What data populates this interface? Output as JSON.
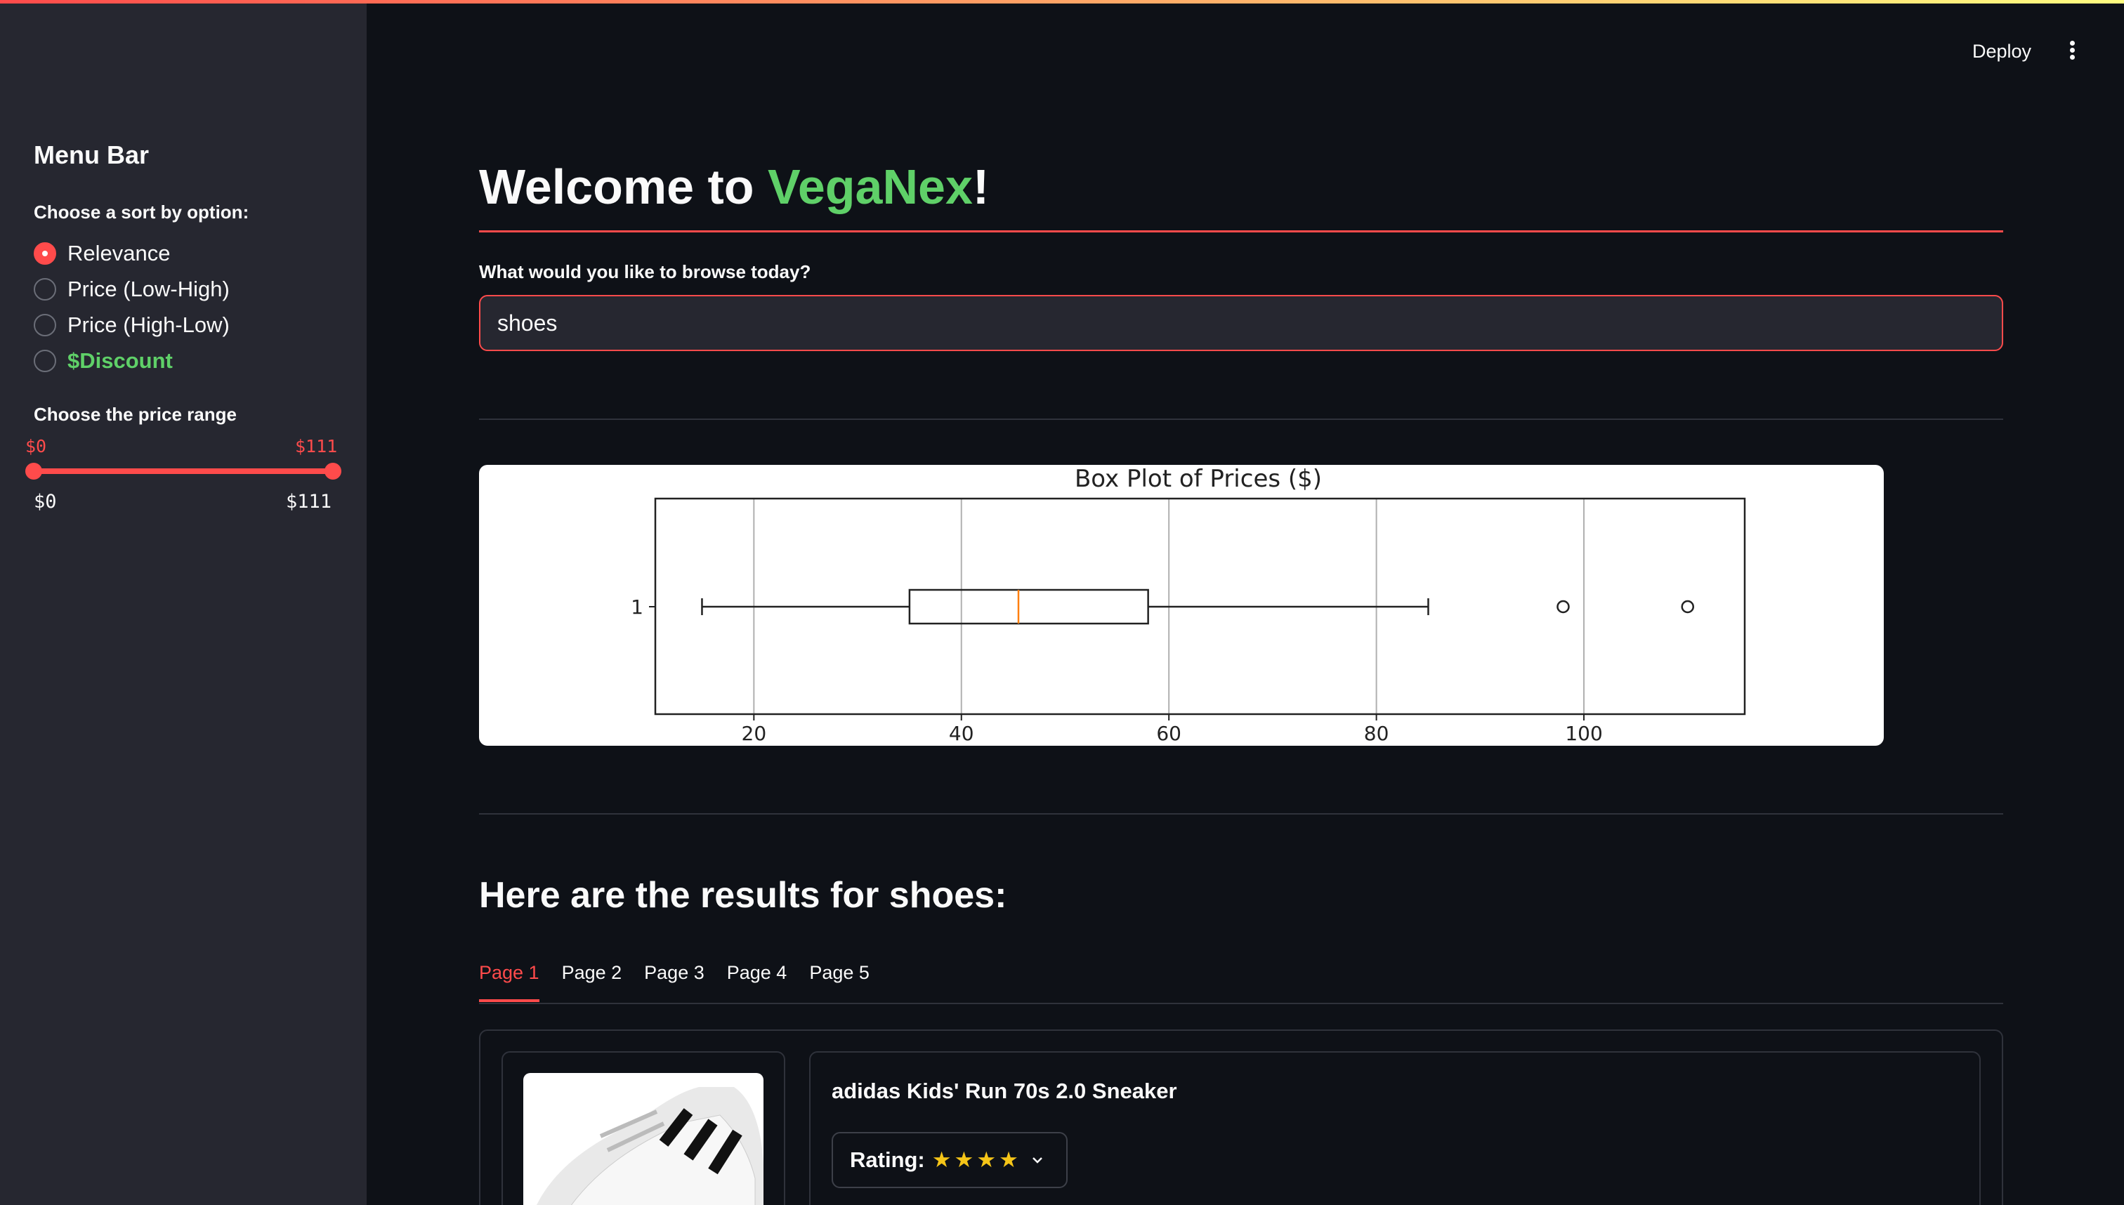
{
  "header": {
    "deploy_label": "Deploy",
    "menu_icon": "vertical-dots-icon"
  },
  "sidebar": {
    "title": "Menu Bar",
    "sort_label": "Choose a sort by option:",
    "sort_options": [
      {
        "label": "Relevance",
        "checked": true
      },
      {
        "label": "Price (Low-High)",
        "checked": false
      },
      {
        "label": "Price (High-Low)",
        "checked": false
      },
      {
        "label": "$Discount",
        "checked": false
      }
    ],
    "price_label": "Choose the price range",
    "price_min": "$0",
    "price_max": "$111",
    "range_min_label": "$0",
    "range_max_label": "$111"
  },
  "main": {
    "welcome_prefix": "Welcome to ",
    "brand": "VegaNex",
    "welcome_suffix": "!",
    "search_label": "What would you like to browse today?",
    "search_value": "shoes",
    "results_heading": "Here are the results for shoes:",
    "tabs": [
      "Page 1",
      "Page 2",
      "Page 3",
      "Page 4",
      "Page 5"
    ],
    "active_tab": 0,
    "product": {
      "name": "adidas Kids' Run 70s 2.0 Sneaker",
      "rating_label": "Rating:",
      "stars": "★★★★",
      "rating_stars": 4
    }
  },
  "colors": {
    "accent": "#ff4b4b",
    "brand": "#5fd068",
    "bg": "#0e1117",
    "sidebar": "#262730"
  },
  "chart_data": {
    "type": "boxplot",
    "title": "Box Plot of Prices ($)",
    "orientation": "horizontal",
    "category": "1",
    "xticks": [
      20,
      40,
      60,
      80,
      100
    ],
    "xlim": [
      10.5,
      115.5
    ],
    "whisker_low": 15,
    "q1": 35,
    "median": 45.5,
    "q3": 58,
    "whisker_high": 85,
    "outliers": [
      98,
      110
    ],
    "grid": "vertical"
  }
}
